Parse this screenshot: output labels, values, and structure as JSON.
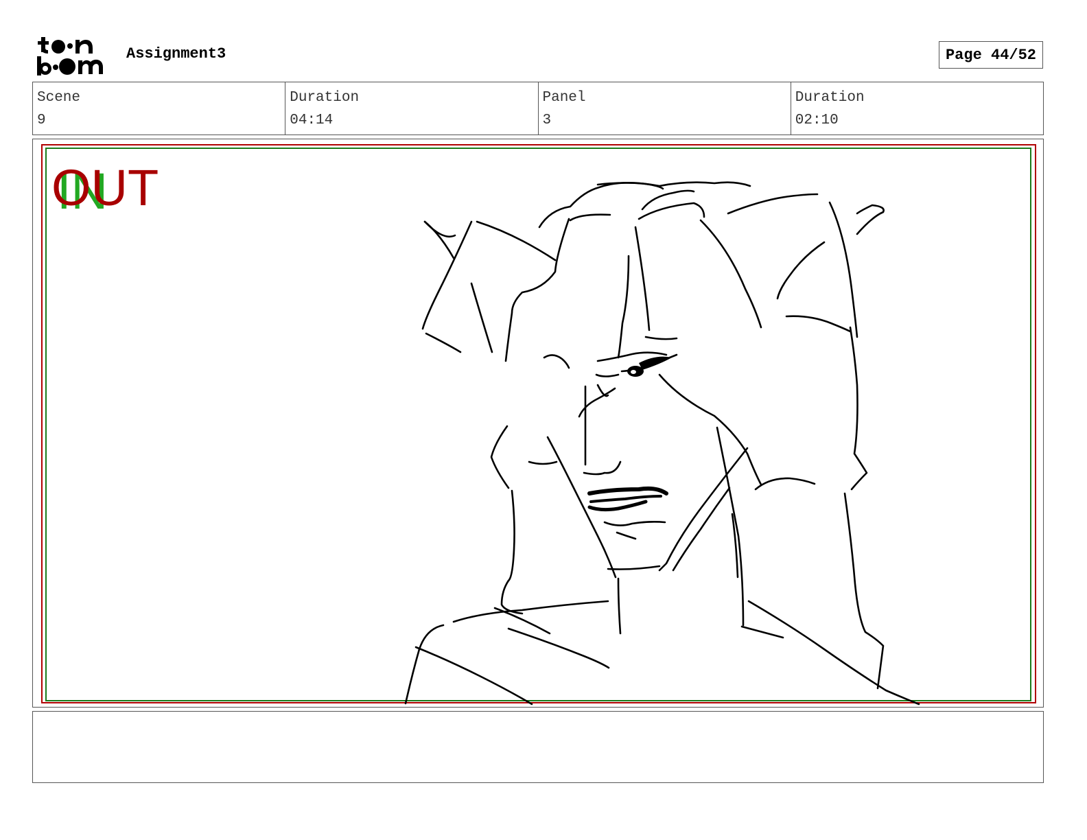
{
  "header": {
    "logo_text": "toon boom",
    "project_title": "Assignment3",
    "page_label": "Page 44/52"
  },
  "info": [
    {
      "label": "Scene",
      "value": "9"
    },
    {
      "label": "Duration",
      "value": "04:14"
    },
    {
      "label": "Panel",
      "value": "3"
    },
    {
      "label": "Duration",
      "value": "02:10"
    }
  ],
  "panel": {
    "in_marker": "IN",
    "out_marker": "OUT",
    "safe_frame_colors": {
      "outer": "#b00000",
      "inner": "#1a7a1a"
    },
    "in_color": "#22a822",
    "out_color": "#a80000"
  },
  "notes": {
    "text": ""
  }
}
